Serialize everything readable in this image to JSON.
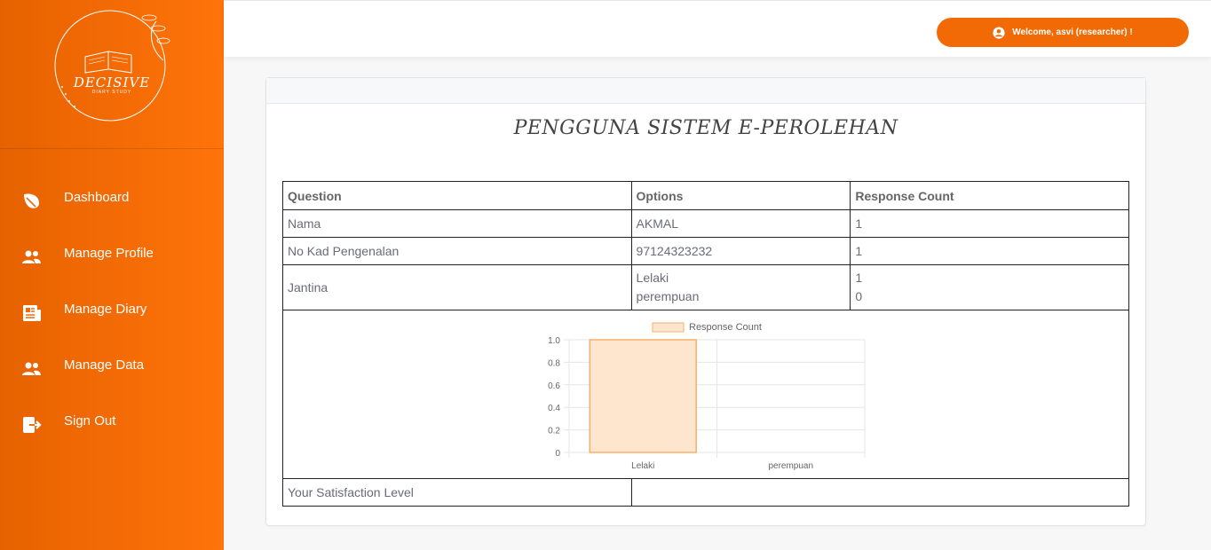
{
  "app": {
    "logo_title": "DECISIVE",
    "logo_subtitle": "DIARY STUDY"
  },
  "sidebar": {
    "items": [
      {
        "label": "Dashboard",
        "icon": "leaf-icon"
      },
      {
        "label": "Manage Profile",
        "icon": "users-icon"
      },
      {
        "label": "Manage Diary",
        "icon": "newspaper-icon"
      },
      {
        "label": "Manage Data",
        "icon": "users-icon"
      },
      {
        "label": "Sign Out",
        "icon": "sign-out-icon"
      }
    ]
  },
  "header": {
    "welcome": "Welcome, asvi (researcher) !"
  },
  "page": {
    "title": "PENGGUNA SISTEM E-PEROLEHAN"
  },
  "table": {
    "headers": [
      "Question",
      "Options",
      "Response Count"
    ],
    "rows": [
      {
        "question": "Nama",
        "options": [
          "AKMAL"
        ],
        "counts": [
          "1"
        ]
      },
      {
        "question": "No Kad Pengenalan",
        "options": [
          "97124323232"
        ],
        "counts": [
          "1"
        ]
      },
      {
        "question": "Jantina",
        "options": [
          "Lelaki",
          "perempuan"
        ],
        "counts": [
          "1",
          "0"
        ]
      }
    ],
    "satisfaction_label": "Your Satisfaction Level"
  },
  "colors": {
    "brand": "#ff730a",
    "bar_fill": "#fde6cd",
    "bar_stroke": "#f7b06a"
  },
  "chart_data": {
    "type": "bar",
    "categories": [
      "Lelaki",
      "perempuan"
    ],
    "series": [
      {
        "name": "Response Count",
        "values": [
          1,
          0
        ]
      }
    ],
    "ylim": [
      0,
      1
    ],
    "yticks": [
      "0",
      "0.2",
      "0.4",
      "0.6",
      "0.8",
      "1.0"
    ],
    "legend": "top",
    "grid": true
  }
}
